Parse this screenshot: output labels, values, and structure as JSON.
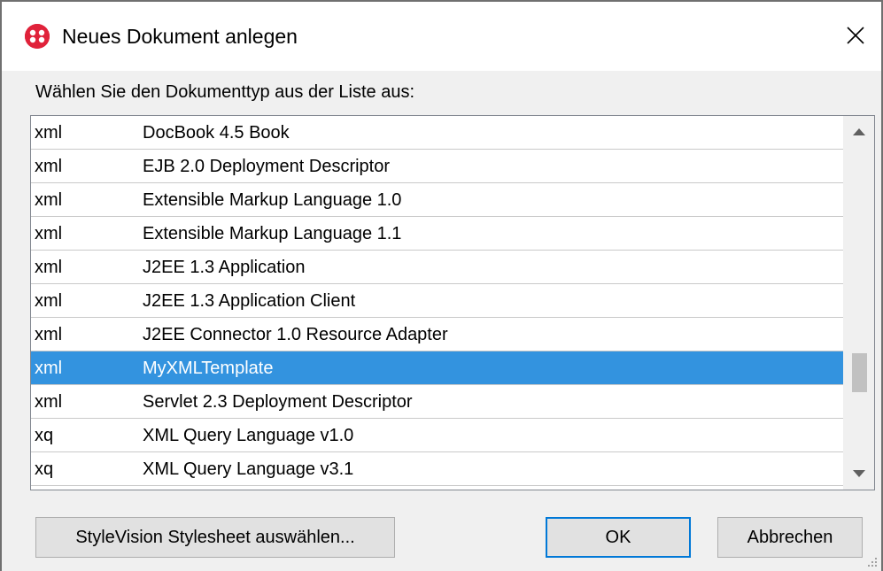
{
  "dialog": {
    "title": "Neues Dokument anlegen",
    "prompt": "Wählen Sie den Dokumenttyp aus der Liste aus:"
  },
  "list": {
    "items": [
      {
        "ext": "xml",
        "name": "DocBook 4.5 Book",
        "selected": false
      },
      {
        "ext": "xml",
        "name": "EJB 2.0 Deployment Descriptor",
        "selected": false
      },
      {
        "ext": "xml",
        "name": "Extensible Markup Language 1.0",
        "selected": false
      },
      {
        "ext": "xml",
        "name": "Extensible Markup Language 1.1",
        "selected": false
      },
      {
        "ext": "xml",
        "name": "J2EE 1.3 Application",
        "selected": false
      },
      {
        "ext": "xml",
        "name": "J2EE 1.3 Application Client",
        "selected": false
      },
      {
        "ext": "xml",
        "name": "J2EE Connector 1.0 Resource Adapter",
        "selected": false
      },
      {
        "ext": "xml",
        "name": "MyXMLTemplate",
        "selected": true
      },
      {
        "ext": "xml",
        "name": "Servlet 2.3 Deployment Descriptor",
        "selected": false
      },
      {
        "ext": "xq",
        "name": "XML Query Language v1.0",
        "selected": false
      },
      {
        "ext": "xq",
        "name": "XML Query Language v3.1",
        "selected": false
      }
    ],
    "scroll_position": 0.88
  },
  "buttons": {
    "stylevision": "StyleVision Stylesheet auswählen...",
    "ok": "OK",
    "cancel": "Abbrechen"
  },
  "icons": {
    "app": "altova-app-icon",
    "close": "close-icon",
    "scroll_up": "scroll-up-arrow-icon",
    "scroll_down": "scroll-down-arrow-icon",
    "resize": "resize-grip-icon"
  },
  "colors": {
    "selection": "#3393df",
    "default_button_border": "#0078d7",
    "app_icon": "#e0223a"
  }
}
